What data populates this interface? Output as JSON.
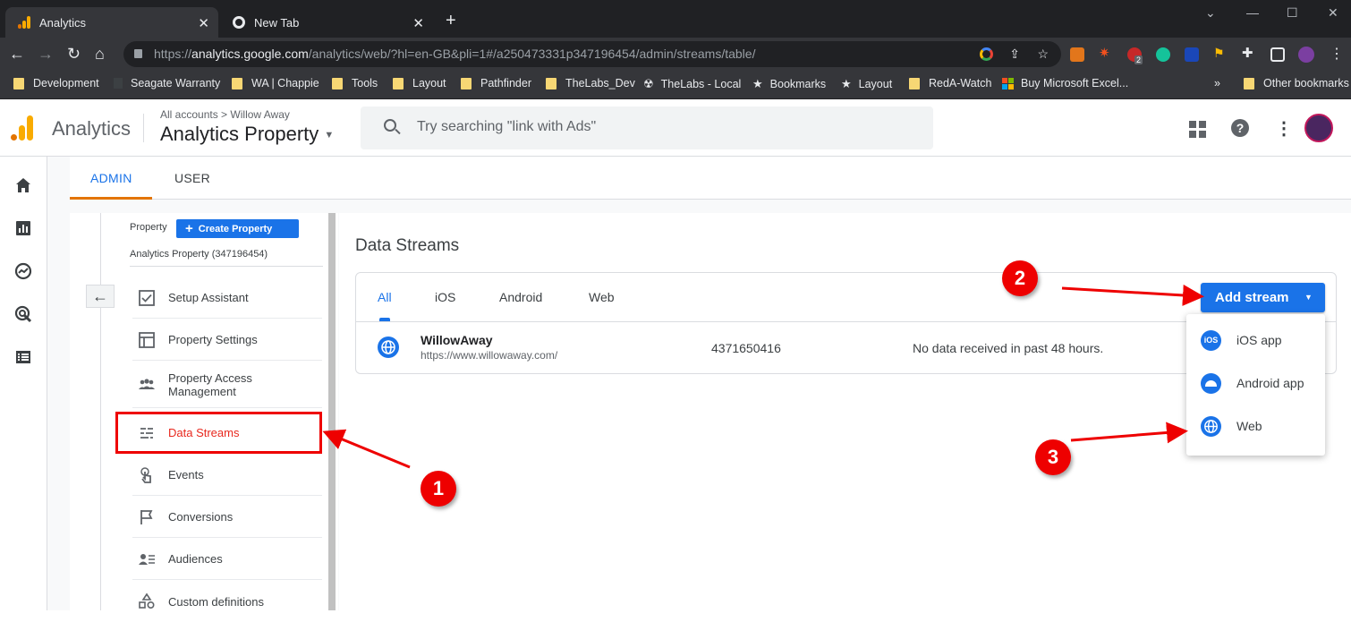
{
  "browser": {
    "tabs": [
      {
        "title": "Analytics",
        "active": true
      },
      {
        "title": "New Tab",
        "active": false
      }
    ],
    "url_prefix": "https://",
    "url_host": "analytics.google.com",
    "url_path": "/analytics/web/?hl=en-GB&pli=1#/a250473331p347196454/admin/streams/table/",
    "extension_badge": "2",
    "bookmarks": [
      {
        "label": "Development",
        "icon": "folder"
      },
      {
        "label": "Seagate Warranty",
        "icon": "page"
      },
      {
        "label": "WA | Chappie",
        "icon": "folder"
      },
      {
        "label": "Tools",
        "icon": "folder"
      },
      {
        "label": "Layout",
        "icon": "folder"
      },
      {
        "label": "Pathfinder",
        "icon": "folder"
      },
      {
        "label": "TheLabs_Dev",
        "icon": "folder"
      },
      {
        "label": "TheLabs - Local",
        "icon": "radiation"
      },
      {
        "label": "Bookmarks",
        "icon": "star"
      },
      {
        "label": "Layout",
        "icon": "star"
      },
      {
        "label": "RedA-Watch",
        "icon": "folder"
      },
      {
        "label": "Buy Microsoft Excel...",
        "icon": "microsoft"
      }
    ],
    "overflow": "»",
    "other_bookmarks": "Other bookmarks"
  },
  "ga": {
    "product": "Analytics",
    "breadcrumb_root": "All accounts",
    "breadcrumb_sep": ">",
    "breadcrumb_account": "Willow Away",
    "property_name": "Analytics Property",
    "search_placeholder": "Try searching \"link with Ads\""
  },
  "admin": {
    "tabs": [
      "ADMIN",
      "USER"
    ],
    "property_label": "Property",
    "create_property": "Create Property",
    "property_detail": "Analytics Property (347196454)",
    "nav": [
      {
        "label": "Setup Assistant",
        "icon": "checkbox-icon"
      },
      {
        "label": "Property Settings",
        "icon": "property-settings-icon"
      },
      {
        "label": "Property Access Management",
        "icon": "people-icon"
      },
      {
        "label": "Data Streams",
        "icon": "data-streams-icon",
        "selected": true
      },
      {
        "label": "Events",
        "icon": "touch-icon"
      },
      {
        "label": "Conversions",
        "icon": "flag-icon"
      },
      {
        "label": "Audiences",
        "icon": "audiences-icon"
      },
      {
        "label": "Custom definitions",
        "icon": "shapes-icon"
      }
    ]
  },
  "streams": {
    "heading": "Data Streams",
    "tabs": [
      "All",
      "iOS",
      "Android",
      "Web"
    ],
    "rows": [
      {
        "name": "WillowAway",
        "url": "https://www.willowaway.com/",
        "id": "4371650416",
        "status": "No data received in past 48 hours."
      }
    ],
    "add_button": "Add stream",
    "menu": [
      {
        "label": "iOS app",
        "icon": "ios-icon"
      },
      {
        "label": "Android app",
        "icon": "android-icon"
      },
      {
        "label": "Web",
        "icon": "globe-icon"
      }
    ]
  },
  "annotations": {
    "badges": [
      "1",
      "2",
      "3"
    ],
    "colors": {
      "annotation": "#e00000",
      "accent": "#1a73e8",
      "selected_text": "#e8281e"
    }
  }
}
